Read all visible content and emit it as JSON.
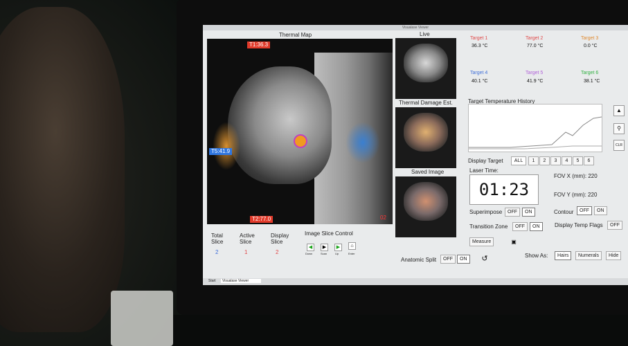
{
  "window": {
    "title": "Visualase Viewer"
  },
  "thermal_map": {
    "title": "Thermal Map",
    "marker_t1": "T1:36.3",
    "marker_t5": "T5:41.9",
    "marker_t2": "T2:77.0",
    "slice_num": "02"
  },
  "thumbs": {
    "live": "Live",
    "damage": "Thermal Damage Est.",
    "saved": "Saved Image"
  },
  "targets": [
    {
      "name": "Target 1",
      "value": "36.3 °C",
      "color": "#e04a4a"
    },
    {
      "name": "Target 2",
      "value": "77.0 °C",
      "color": "#e04a4a"
    },
    {
      "name": "Target 3",
      "value": "0.0 °C",
      "color": "#e08a30"
    },
    {
      "name": "Target 4",
      "value": "40.1 °C",
      "color": "#3f6fd8"
    },
    {
      "name": "Target 5",
      "value": "41.9 °C",
      "color": "#b060d8"
    },
    {
      "name": "Target 6",
      "value": "38.1 °C",
      "color": "#30b040"
    }
  ],
  "history": {
    "title": "Target Temperature History"
  },
  "display_target": {
    "label": "Display Target",
    "all": "ALL",
    "options": [
      "1",
      "2",
      "3",
      "4",
      "5",
      "6"
    ]
  },
  "laser": {
    "label": "Laser Time:",
    "time": "01:23"
  },
  "fov": {
    "x": "FOV X (mm): 220",
    "y": "FOV Y (mm): 220"
  },
  "slices": {
    "total_label": "Total Slice",
    "total_value": "2",
    "active_label": "Active Slice",
    "active_value": "1",
    "display_label": "Display Slice",
    "display_value": "2",
    "control_label": "Image Slice Control",
    "buttons": [
      "Down",
      "Scan",
      "Up",
      "Enter"
    ]
  },
  "toggles": {
    "superimpose": "Superimpose",
    "contour": "Contour",
    "transition": "Transition Zone",
    "flags": "Display Temp Flags",
    "anatomic": "Anatomic Split",
    "off": "OFF",
    "on": "ON"
  },
  "measure": "Measure",
  "show_as": {
    "label": "Show As:",
    "hairs": "Hairs",
    "numerals": "Numerals",
    "hide": "Hide"
  },
  "side_buttons": {
    "clr": "CLR"
  },
  "taskbar": {
    "start": "Start",
    "app": "Visualase Viewer"
  }
}
